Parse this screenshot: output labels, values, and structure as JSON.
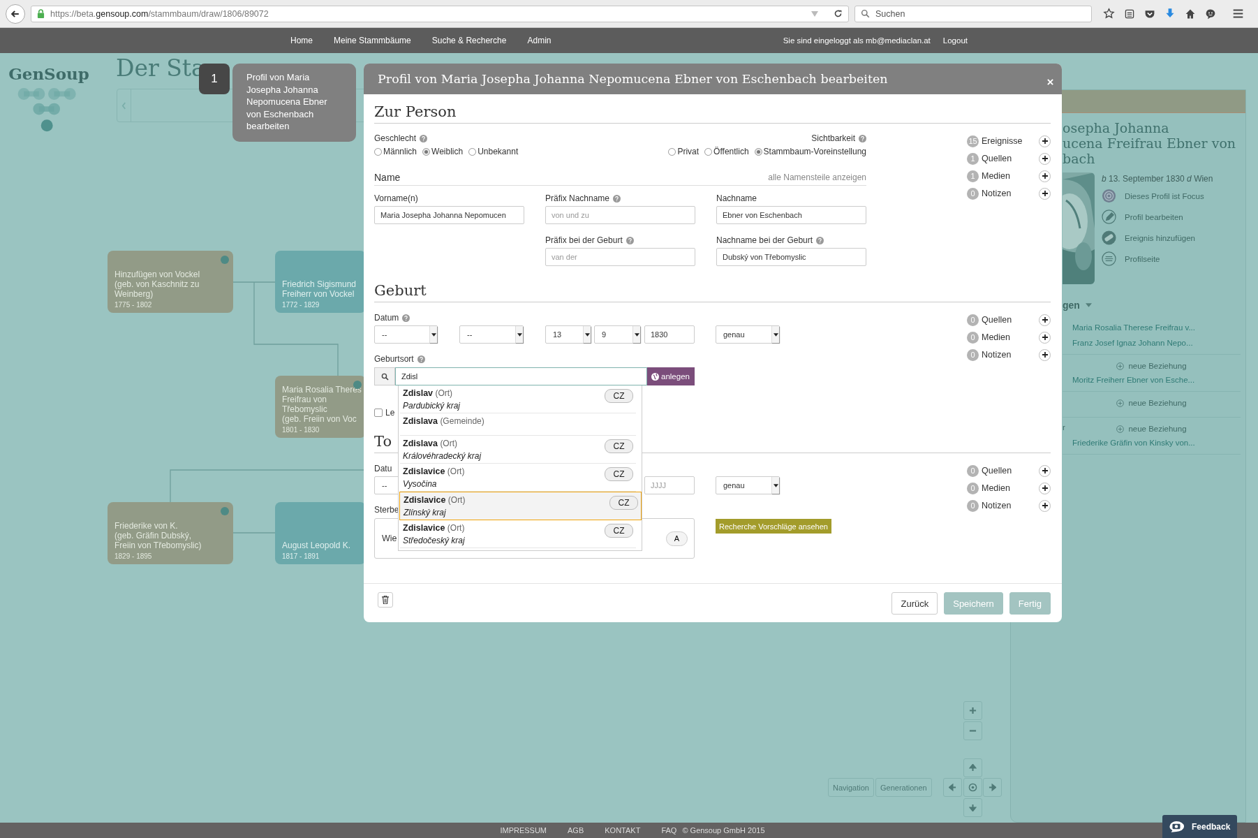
{
  "browser": {
    "url_prefix": "https://beta.",
    "url_domain": "gensoup.com",
    "url_path": "/stammbaum/draw/1806/89072",
    "search_placeholder": "Suchen"
  },
  "nav": {
    "items": [
      "Home",
      "Meine Stammbäume",
      "Suche & Recherche",
      "Admin"
    ],
    "login_text": "Sie sind eingeloggt als",
    "user": "mb@mediaclan.at",
    "logout": "Logout"
  },
  "logo": {
    "text": "GenSoup"
  },
  "page_title": "Der Sta",
  "tree": [
    {
      "kind": "female",
      "lines": [
        "Hinzufügen von Vockel",
        "(geb. von Kaschnitz zu",
        "Weinberg)"
      ],
      "years": "1775 - 1802"
    },
    {
      "kind": "male",
      "lines": [
        "Friedrich Sigismund",
        "Freiherr von Vockel"
      ],
      "years": "1772 - 1829"
    },
    {
      "kind": "female",
      "lines": [
        "Maria Rosalia Theres",
        "Freifrau von",
        "Třebomyslic",
        "(geb. Freiin von Voc"
      ],
      "years": "1801 - 1830"
    },
    {
      "kind": "female",
      "lines": [
        "Friederike von K.",
        "(geb. Gräfin Dubský,",
        "Freiin von Třebomyslic)"
      ],
      "years": "1829 - 1895"
    },
    {
      "kind": "male",
      "lines": [
        "August Leopold K."
      ],
      "years": "1817 - 1891"
    }
  ],
  "tour": {
    "step": "1",
    "text": "Profil von Maria Josepha Johanna Nepomucena Ebner von Eschenbach bearbeiten"
  },
  "modal": {
    "title": "Profil von Maria Josepha Johanna Nepomucena Ebner von Eschenbach bearbeiten",
    "person": {
      "heading": "Zur Person",
      "gender": {
        "label": "Geschlecht",
        "options": [
          {
            "label": "Männlich",
            "selected": false
          },
          {
            "label": "Weiblich",
            "selected": true
          },
          {
            "label": "Unbekannt",
            "selected": false
          }
        ]
      },
      "visibility": {
        "label": "Sichtbarkeit",
        "options": [
          {
            "label": "Privat",
            "selected": false
          },
          {
            "label": "Öffentlich",
            "selected": false
          },
          {
            "label": "Stammbaum-Voreinstellung",
            "selected": true
          }
        ]
      },
      "name_heading": "Name",
      "show_all_link": "alle Namensteile anzeigen",
      "fields": [
        {
          "label": "Vorname(n)",
          "help": false,
          "value": "Maria Josepha Johanna Nepomucen"
        },
        {
          "label": "Präfix Nachname",
          "help": true,
          "placeholder": "von und zu"
        },
        {
          "label": "Nachname",
          "help": false,
          "value": "Ebner von Eschenbach"
        },
        {
          "label": "Präfix bei der Geburt",
          "help": true,
          "placeholder": "van der"
        },
        {
          "label": "Nachname bei der Geburt",
          "help": true,
          "value": "Dubský von Třebomyslic"
        }
      ],
      "counts": [
        {
          "count": "15",
          "label": "Ereignisse"
        },
        {
          "count": "1",
          "label": "Quellen"
        },
        {
          "count": "1",
          "label": "Medien"
        },
        {
          "count": "0",
          "label": "Notizen"
        }
      ]
    },
    "birth": {
      "heading": "Geburt",
      "date_label": "Datum",
      "date_items": [
        {
          "kind": "select",
          "value": "--"
        },
        {
          "kind": "select",
          "value": "--"
        },
        {
          "kind": "select",
          "value": "13"
        },
        {
          "kind": "select",
          "value": "9"
        },
        {
          "kind": "input",
          "value": "1830"
        },
        {
          "kind": "select",
          "value": "genau"
        }
      ],
      "place_label": "Geburtsort",
      "place_query": "Zdisl",
      "create_button": "anlegen",
      "alive_label": "Le",
      "alive_checked": false,
      "suggestions": [
        {
          "name": "Zdislav",
          "type": "(Ort)",
          "region": "Pardubický kraj",
          "country": "CZ",
          "selected": false
        },
        {
          "name": "Zdislava",
          "type": "(Gemeinde)",
          "selected": false
        },
        {
          "name": "Zdislava",
          "type": "(Ort)",
          "region": "Královéhradecký kraj",
          "country": "CZ",
          "selected": false
        },
        {
          "name": "Zdislavice",
          "type": "(Ort)",
          "region": "Vysočina",
          "country": "CZ",
          "selected": false
        },
        {
          "name": "Zdislavice",
          "type": "(Ort)",
          "region": "Zlínský kraj",
          "country": "CZ",
          "selected": true
        },
        {
          "name": "Zdislavice",
          "type": "(Ort)",
          "region": "Středočeský kraj",
          "country": "CZ",
          "selected": false
        }
      ],
      "counts": [
        {
          "count": "0",
          "label": "Quellen"
        },
        {
          "count": "0",
          "label": "Medien"
        },
        {
          "count": "0",
          "label": "Notizen"
        }
      ]
    },
    "death": {
      "heading": "To",
      "date_label": "Datu",
      "date_items": [
        {
          "kind": "select",
          "value": "--"
        },
        {
          "kind": "input",
          "placeholder": "JJJJ"
        },
        {
          "kind": "select",
          "value": "genau"
        }
      ],
      "place_label": "Sterbe",
      "place_value": "Wie",
      "place_button": "A",
      "research_button": "Recherche Vorschläge ansehen",
      "counts": [
        {
          "count": "0",
          "label": "Quellen"
        },
        {
          "count": "0",
          "label": "Medien"
        },
        {
          "count": "0",
          "label": "Notizen"
        }
      ]
    },
    "buttons": [
      {
        "label": "Zurück",
        "disabled": false
      },
      {
        "label": "Speichern",
        "disabled": true
      },
      {
        "label": "Fertig",
        "disabled": true
      }
    ]
  },
  "profile_panel": {
    "title_lines": [
      "osepha Johanna",
      "ucena Freifrau Ebner von",
      "bach"
    ],
    "birth": "*b* 13. September 1830 *d* Wien",
    "actions": [
      {
        "kind": "focus",
        "label": "Dieses Profil ist Focus"
      },
      {
        "kind": "edit",
        "label": "Profil bearbeiten"
      },
      {
        "kind": "event",
        "label": "Ereignis hinzufügen"
      },
      {
        "kind": "page",
        "label": "Profilseite"
      }
    ],
    "relations_heading": "gen",
    "relations": [
      {
        "kind": "link",
        "text": "Maria Rosalia Therese Freifrau v..."
      },
      {
        "kind": "link",
        "text": "Franz Josef Ignaz Johann Nepo..."
      },
      {
        "kind": "add",
        "text": "neue Beziehung"
      },
      {
        "kind": "link",
        "text": "Moritz Freiherr Ebner von Esche..."
      },
      {
        "kind": "add",
        "text": "neue Beziehung"
      },
      {
        "kind": "add",
        "text": "neue Beziehung",
        "side_label": "r"
      },
      {
        "kind": "link",
        "text": "Friederike Gräfin von Kinsky von..."
      }
    ]
  },
  "map_controls": {
    "tabs": [
      "Navigation",
      "Generationen"
    ]
  },
  "footer": {
    "links": [
      "IMPRESSUM",
      "AGB",
      "KONTAKT",
      "FAQ"
    ],
    "copyright": "© Gensoup GmbH 2015"
  },
  "feedback": "Feedback"
}
